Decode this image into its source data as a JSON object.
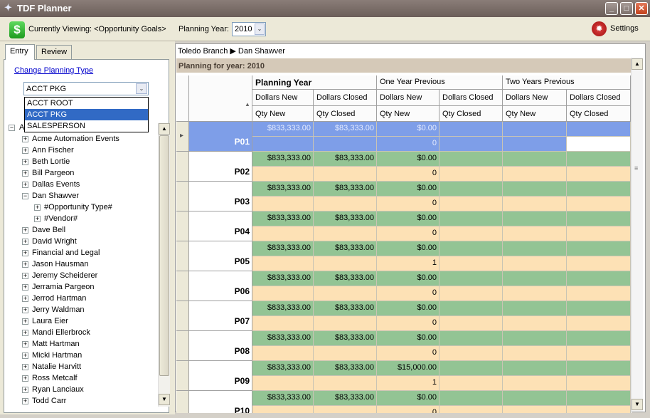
{
  "window": {
    "title": "TDF Planner",
    "controls": {
      "minimize": "_",
      "maximize": "□",
      "close": "✕"
    }
  },
  "toolbar": {
    "currently_viewing": "Currently Viewing: <Opportunity Goals>",
    "planning_year_label": "Planning Year:",
    "planning_year_value": "2010",
    "settings_label": "Settings",
    "dropdown_arrow": "⌄"
  },
  "tabs": [
    {
      "label": "Entry"
    },
    {
      "label": "Review"
    }
  ],
  "left": {
    "change_planning_type": "Change Planning Type",
    "planning_type_value": "ACCT PKG",
    "planning_type_options": [
      {
        "label": "ACCT ROOT"
      },
      {
        "label": "ACCT PKG"
      },
      {
        "label": "SALESPERSON"
      }
    ],
    "tree_root_fragment": "A",
    "tree": [
      {
        "label": "Acme Automation Events",
        "expander": "+"
      },
      {
        "label": "Ann Fischer",
        "expander": "+"
      },
      {
        "label": "Beth Lortie",
        "expander": "+"
      },
      {
        "label": "Bill Pargeon",
        "expander": "+"
      },
      {
        "label": "Dallas Events",
        "expander": "+"
      },
      {
        "label": "Dan Shawver",
        "expander": "−"
      },
      {
        "label": "#Opportunity Type#",
        "expander": "+"
      },
      {
        "label": "#Vendor#",
        "expander": "+"
      },
      {
        "label": "Dave Bell",
        "expander": "+"
      },
      {
        "label": "David Wright",
        "expander": "+"
      },
      {
        "label": "Financial and Legal",
        "expander": "+"
      },
      {
        "label": "Jason Hausman",
        "expander": "+"
      },
      {
        "label": "Jeremy Scheiderer",
        "expander": "+"
      },
      {
        "label": "Jerramia Pargeon",
        "expander": "+"
      },
      {
        "label": "Jerrod Hartman",
        "expander": "+"
      },
      {
        "label": "Jerry Waldman",
        "expander": "+"
      },
      {
        "label": "Laura Eier",
        "expander": "+"
      },
      {
        "label": "Mandi Ellerbrock",
        "expander": "+"
      },
      {
        "label": "Matt Hartman",
        "expander": "+"
      },
      {
        "label": "Micki Hartman",
        "expander": "+"
      },
      {
        "label": "Natalie Harvitt",
        "expander": "+"
      },
      {
        "label": "Ross Metcalf",
        "expander": "+"
      },
      {
        "label": "Ryan Lanciaux",
        "expander": "+"
      },
      {
        "label": "Todd Carr",
        "expander": "+"
      }
    ],
    "scroll_up": "▲",
    "scroll_down": "▼"
  },
  "right": {
    "breadcrumb": "Toledo Branch  ▶ Dan Shawver",
    "planning_for": "Planning for year: 2010",
    "groups": [
      "Planning Year",
      "One Year Previous",
      "Two Years Previous"
    ],
    "dollar_headers": [
      "Dollars New",
      "Dollars Closed",
      "Dollars New",
      "Dollars Closed",
      "Dollars New",
      "Dollars Closed"
    ],
    "qty_headers": [
      "Qty New",
      "Qty Closed",
      "Qty New",
      "Qty Closed",
      "Qty New",
      "Qty Closed"
    ],
    "sort_glyph": "▲",
    "row_marker": "▸",
    "scroll_up": "▲",
    "scroll_down": "▼",
    "grip": "≡",
    "rows": [
      {
        "period": "P01",
        "dollars": [
          "$833,333.00",
          "$83,333.00",
          "$0.00",
          "",
          "",
          ""
        ],
        "qty": [
          "",
          "",
          "0",
          "",
          "",
          ""
        ]
      },
      {
        "period": "P02",
        "dollars": [
          "$833,333.00",
          "$83,333.00",
          "$0.00",
          "",
          "",
          ""
        ],
        "qty": [
          "",
          "",
          "0",
          "",
          "",
          ""
        ]
      },
      {
        "period": "P03",
        "dollars": [
          "$833,333.00",
          "$83,333.00",
          "$0.00",
          "",
          "",
          ""
        ],
        "qty": [
          "",
          "",
          "0",
          "",
          "",
          ""
        ]
      },
      {
        "period": "P04",
        "dollars": [
          "$833,333.00",
          "$83,333.00",
          "$0.00",
          "",
          "",
          ""
        ],
        "qty": [
          "",
          "",
          "0",
          "",
          "",
          ""
        ]
      },
      {
        "period": "P05",
        "dollars": [
          "$833,333.00",
          "$83,333.00",
          "$0.00",
          "",
          "",
          ""
        ],
        "qty": [
          "",
          "",
          "1",
          "",
          "",
          ""
        ]
      },
      {
        "period": "P06",
        "dollars": [
          "$833,333.00",
          "$83,333.00",
          "$0.00",
          "",
          "",
          ""
        ],
        "qty": [
          "",
          "",
          "0",
          "",
          "",
          ""
        ]
      },
      {
        "period": "P07",
        "dollars": [
          "$833,333.00",
          "$83,333.00",
          "$0.00",
          "",
          "",
          ""
        ],
        "qty": [
          "",
          "",
          "0",
          "",
          "",
          ""
        ]
      },
      {
        "period": "P08",
        "dollars": [
          "$833,333.00",
          "$83,333.00",
          "$0.00",
          "",
          "",
          ""
        ],
        "qty": [
          "",
          "",
          "0",
          "",
          "",
          ""
        ]
      },
      {
        "period": "P09",
        "dollars": [
          "$833,333.00",
          "$83,333.00",
          "$15,000.00",
          "",
          "",
          ""
        ],
        "qty": [
          "",
          "",
          "1",
          "",
          "",
          ""
        ]
      },
      {
        "period": "P10",
        "dollars": [
          "$833,333.00",
          "$83,333.00",
          "$0.00",
          "",
          "",
          ""
        ],
        "qty": [
          "",
          "",
          "0",
          "",
          "",
          ""
        ]
      }
    ]
  }
}
